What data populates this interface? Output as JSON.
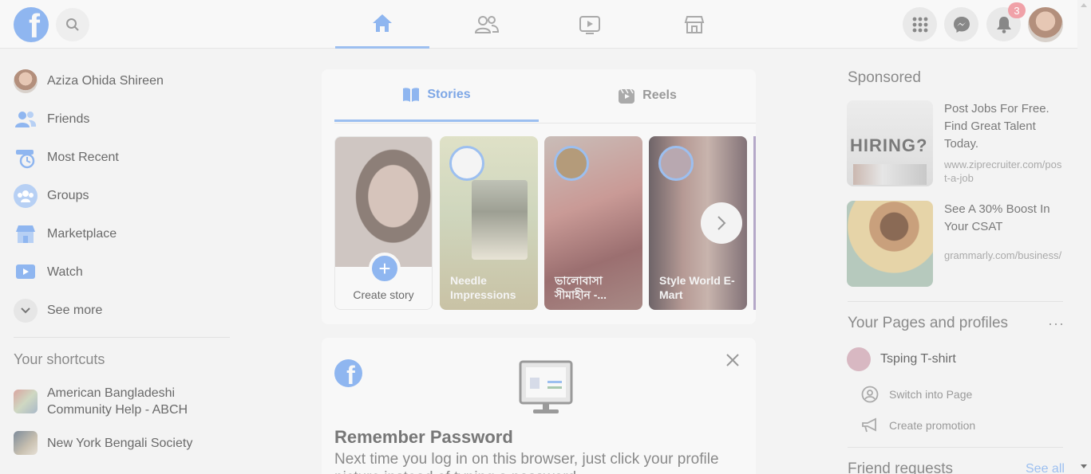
{
  "topbar": {
    "logo": "f",
    "nav_tabs": [
      "home-icon",
      "friends-icon",
      "watch-icon",
      "marketplace-icon"
    ],
    "notifications_count": "3"
  },
  "left_sidebar": {
    "profile_name": "Aziza Ohida Shireen",
    "items": [
      {
        "label": "Friends",
        "icon": "friends-icon"
      },
      {
        "label": "Most Recent",
        "icon": "clock-icon"
      },
      {
        "label": "Groups",
        "icon": "groups-icon"
      },
      {
        "label": "Marketplace",
        "icon": "marketplace-icon"
      },
      {
        "label": "Watch",
        "icon": "watch-icon"
      },
      {
        "label": "See more",
        "icon": "chevron-down-icon"
      }
    ],
    "shortcuts_title": "Your shortcuts",
    "shortcuts": [
      {
        "label": "American Bangladeshi Community Help - ABCH"
      },
      {
        "label": "New York Bengali Society"
      }
    ]
  },
  "stories": {
    "tab_stories": "Stories",
    "tab_reels": "Reels",
    "create_label": "Create story",
    "cards": [
      {
        "name": "Needle Impressions"
      },
      {
        "name": "ভালোবাসা সীমাহীন -..."
      },
      {
        "name": "Style World E-Mart"
      }
    ]
  },
  "password_card": {
    "logo": "f",
    "title": "Remember Password",
    "text": "Next time you log in on this browser, just click your profile picture instead of typing a password."
  },
  "right_column": {
    "sponsored_title": "Sponsored",
    "ads": [
      {
        "title": "Post Jobs For Free. Find Great Talent Today.",
        "url": "www.ziprecruiter.com/post-a-job",
        "image_text": "HIRING?"
      },
      {
        "title": "See A 30% Boost In Your CSAT",
        "url": "grammarly.com/business/"
      }
    ],
    "pages_title": "Your Pages and profiles",
    "page_name": "Tsping T-shirt",
    "switch_label": "Switch into Page",
    "promo_label": "Create promotion",
    "friend_requests_title": "Friend requests",
    "see_all": "See all"
  }
}
